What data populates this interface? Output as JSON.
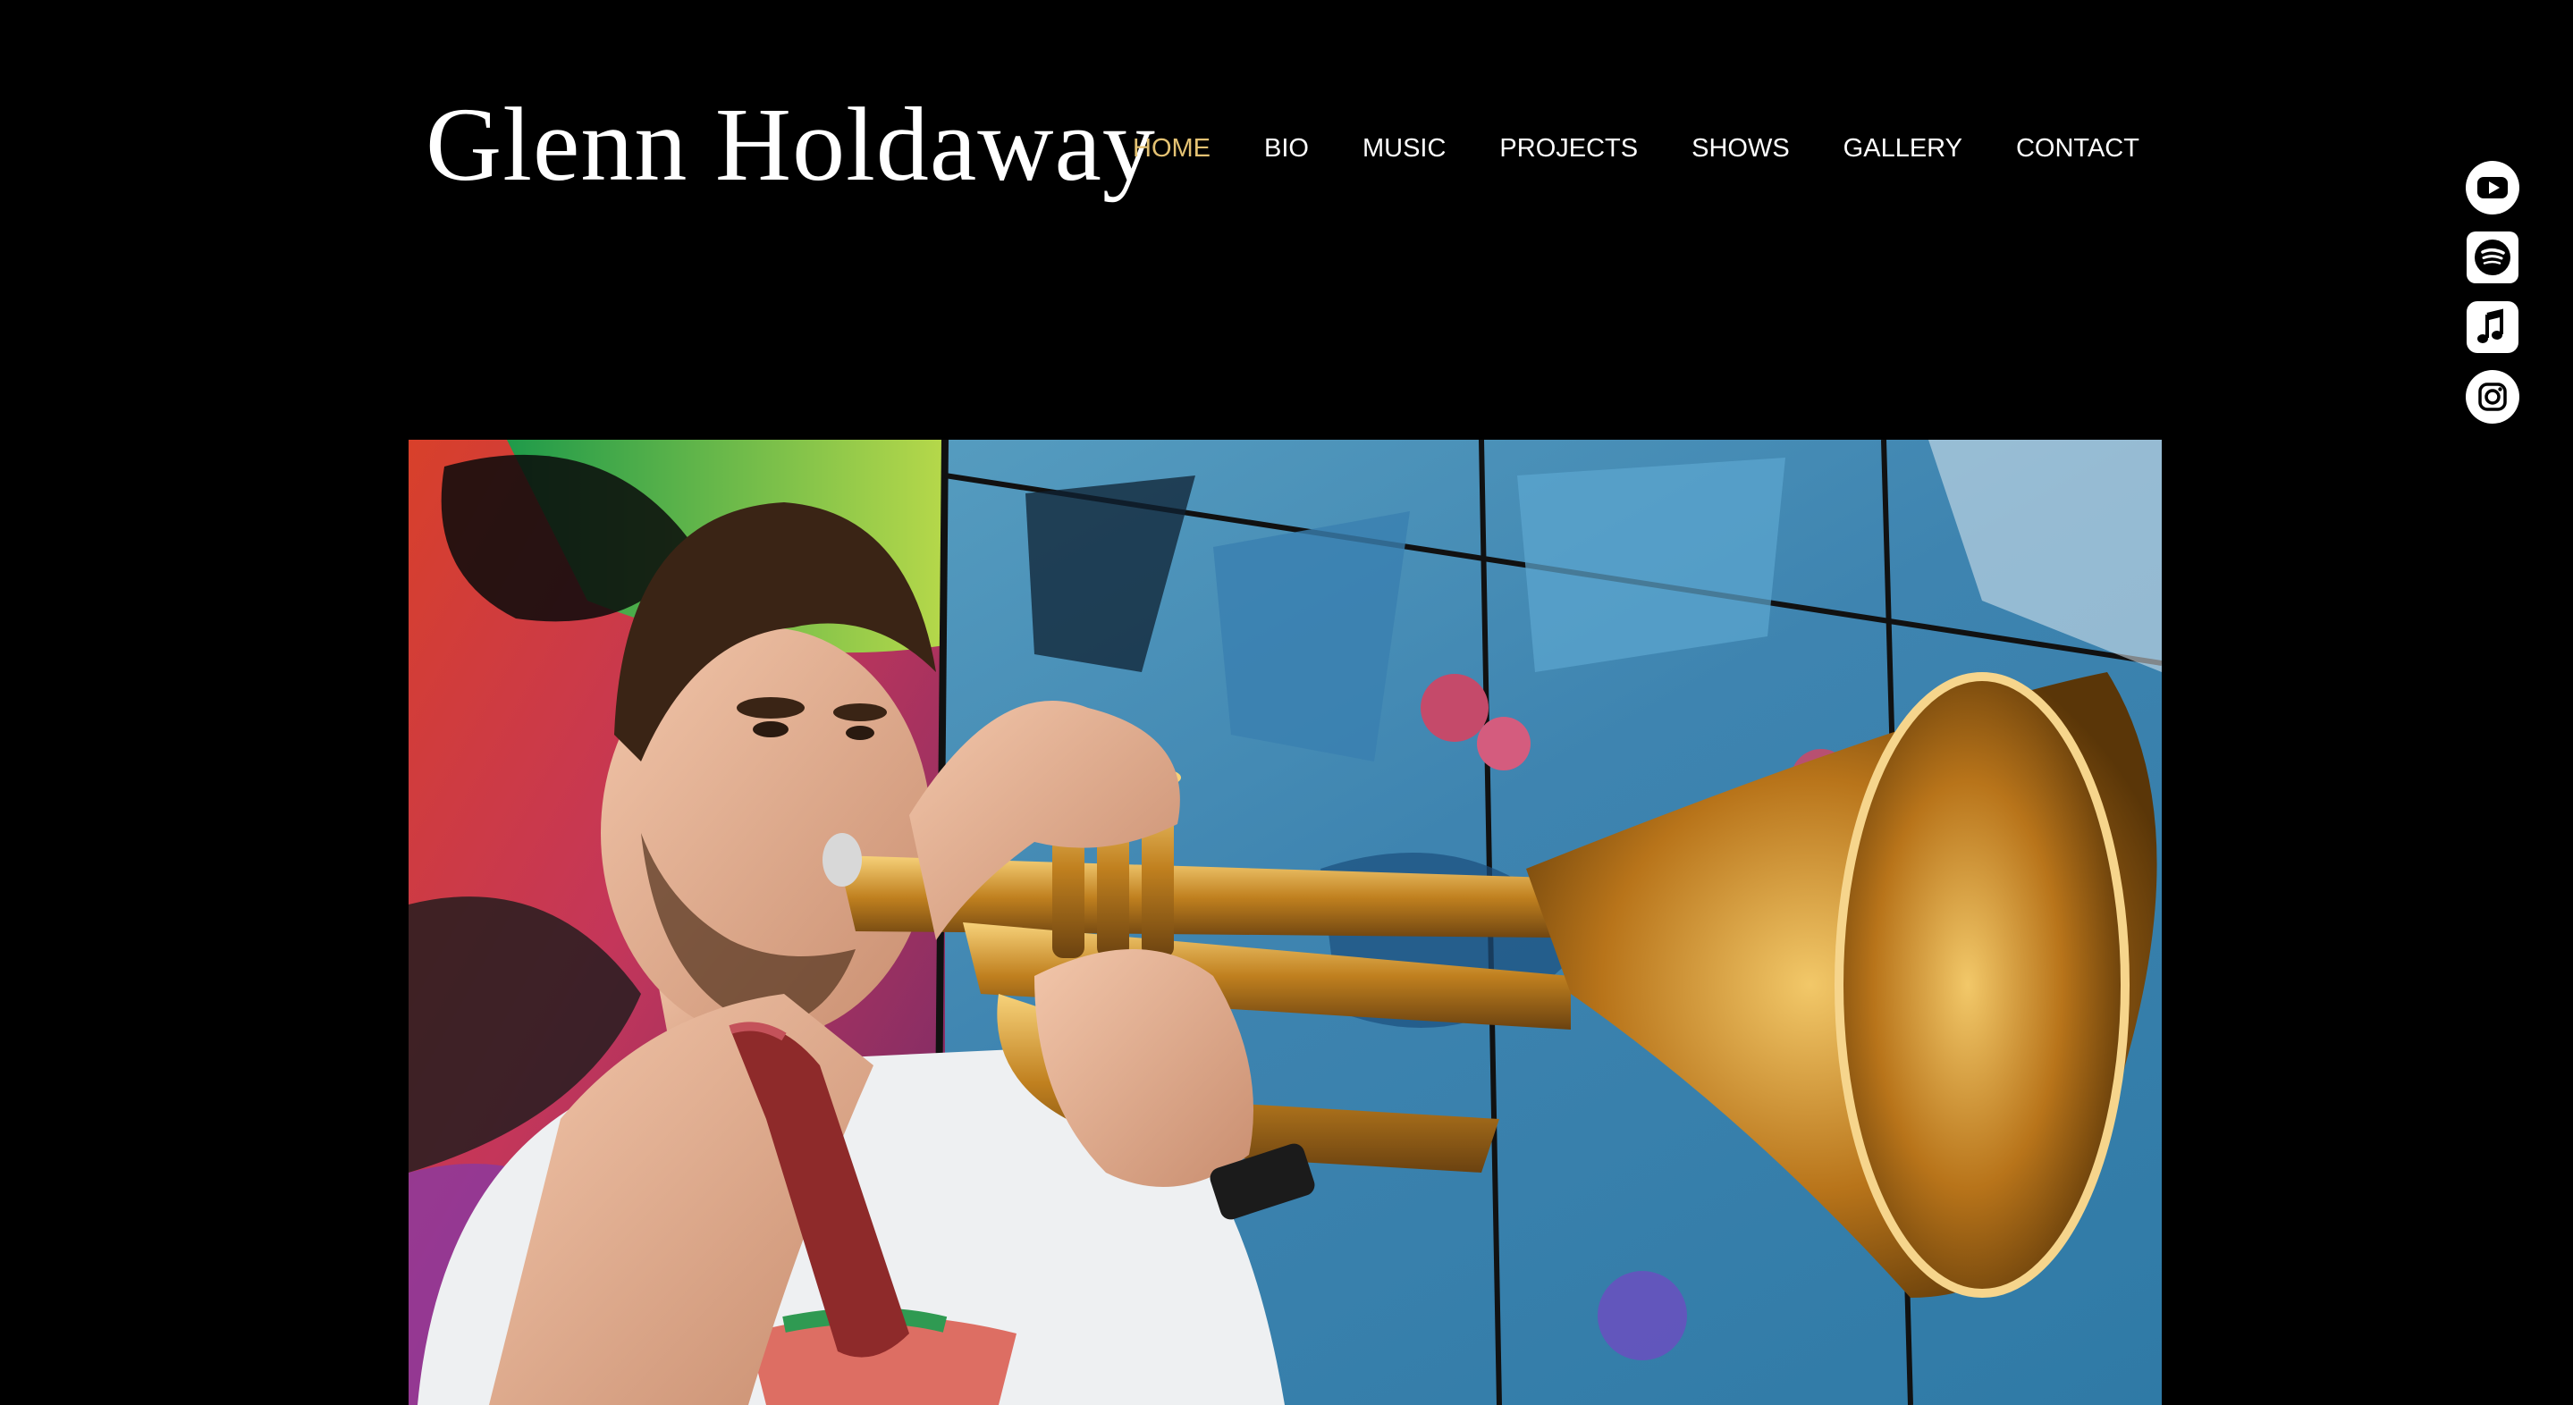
{
  "site": {
    "title": "Glenn Holdaway"
  },
  "nav": {
    "items": [
      {
        "label": "HOME",
        "active": true
      },
      {
        "label": "BIO",
        "active": false
      },
      {
        "label": "MUSIC",
        "active": false
      },
      {
        "label": "PROJECTS",
        "active": false
      },
      {
        "label": "SHOWS",
        "active": false
      },
      {
        "label": "GALLERY",
        "active": false
      },
      {
        "label": "CONTACT",
        "active": false
      }
    ]
  },
  "social": [
    {
      "name": "youtube-icon"
    },
    {
      "name": "spotify-icon"
    },
    {
      "name": "apple-music-icon"
    },
    {
      "name": "instagram-icon"
    }
  ],
  "hero": {
    "subject": "trumpet-player-photo"
  },
  "colors": {
    "background": "#000000",
    "nav_text": "#ffffff",
    "nav_active": "#e4c273"
  }
}
